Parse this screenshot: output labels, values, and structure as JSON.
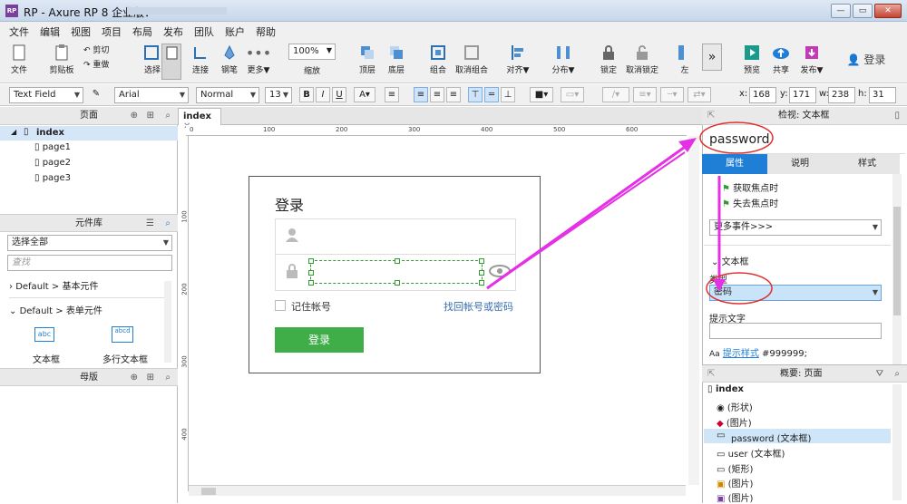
{
  "window": {
    "title": "RP - Axure RP 8 企业版："
  },
  "menu": [
    "文件",
    "编辑",
    "视图",
    "项目",
    "布局",
    "发布",
    "团队",
    "账户",
    "帮助"
  ],
  "toolbar": {
    "file": "文件",
    "clipboard": "剪贴板",
    "cut": "剪切",
    "redo": "重做",
    "select": "选择",
    "connect": "连接",
    "pen": "钢笔",
    "more": "更多▼",
    "zoom": "100%",
    "zoom_label": "缩放",
    "top": "顶层",
    "bottom": "底层",
    "group": "组合",
    "ungroup": "取消组合",
    "align": "对齐▼",
    "distribute": "分布▼",
    "lock": "锁定",
    "unlock": "取消锁定",
    "left": "左",
    "preview": "预览",
    "share": "共享",
    "publish": "发布▼",
    "login": "登录"
  },
  "format": {
    "widget_type": "Text Field",
    "font": "Arial",
    "style": "Normal",
    "size": "13",
    "x_label": "x:",
    "x": "168",
    "y_label": "y:",
    "y": "171",
    "w_label": "w:",
    "w": "238",
    "h_label": "h:",
    "h": "31"
  },
  "pages_panel": {
    "title": "页面",
    "root": "index",
    "pages": [
      "page1",
      "page2",
      "page3"
    ]
  },
  "library_panel": {
    "title": "元件库",
    "select": "选择全部",
    "search_placeholder": "查找",
    "groups": [
      "Default > 基本元件",
      "Default > 表单元件"
    ],
    "items": [
      {
        "label": "文本框",
        "icon": "abc"
      },
      {
        "label": "多行文本框",
        "icon": "abcd"
      }
    ]
  },
  "masters_panel": {
    "title": "母版"
  },
  "canvas": {
    "tab": "index",
    "ruler_h": [
      "0",
      "100",
      "200",
      "300",
      "400",
      "500",
      "600"
    ],
    "ruler_v": [
      "100",
      "200",
      "300",
      "400"
    ]
  },
  "mock": {
    "title": "登录",
    "remember": "记住帐号",
    "forgot": "找回帐号或密码",
    "button": "登录",
    "green": "#3fae49"
  },
  "inspector": {
    "title": "检视: 文本框",
    "widget_name": "password",
    "tabs": [
      "属性",
      "说明",
      "样式"
    ],
    "events": [
      "获取焦点时",
      "失去焦点时"
    ],
    "more_events": "更多事件>>>",
    "section": "文本框",
    "type_label": "类型",
    "type_value": "密码",
    "hint_label": "提示文字",
    "hint_style_link": "提示样式",
    "hint_color": "#999999;"
  },
  "outline": {
    "title": "概要: 页面",
    "root": "index",
    "items": [
      "(形状)",
      "(图片)",
      "password (文本框)",
      "user (文本框)",
      "(矩形)",
      "(图片)",
      "(图片)"
    ]
  },
  "colors": {
    "accent": "#1f7fd6",
    "annotation": "#e531e5",
    "selection": "#2e9c2e"
  }
}
